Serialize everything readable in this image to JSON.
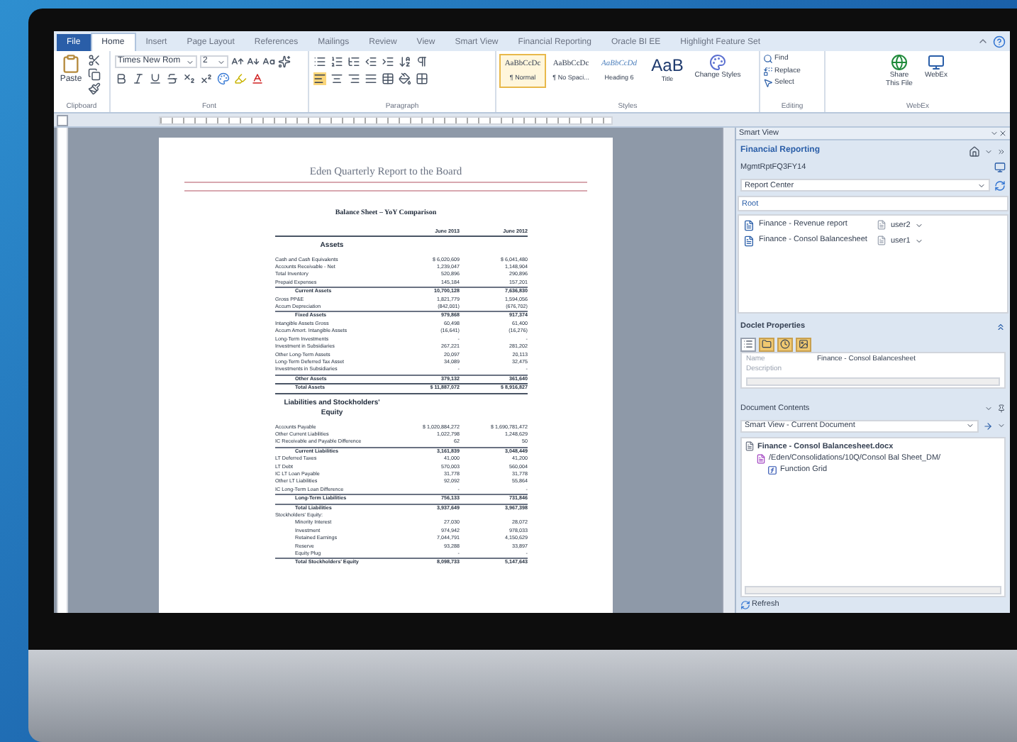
{
  "ribbon_tabs": [
    {
      "label": "File",
      "kind": "file",
      "selected": false
    },
    {
      "label": "Home",
      "kind": "tab",
      "selected": true
    },
    {
      "label": "Insert",
      "kind": "tab",
      "selected": false
    },
    {
      "label": "Page Layout",
      "kind": "tab",
      "selected": false
    },
    {
      "label": "References",
      "kind": "tab",
      "selected": false
    },
    {
      "label": "Mailings",
      "kind": "tab",
      "selected": false
    },
    {
      "label": "Review",
      "kind": "tab",
      "selected": false
    },
    {
      "label": "View",
      "kind": "tab",
      "selected": false
    },
    {
      "label": "Smart View",
      "kind": "tab",
      "selected": false
    },
    {
      "label": "Financial Reporting",
      "kind": "tab",
      "selected": false
    },
    {
      "label": "Oracle BI EE",
      "kind": "tab",
      "selected": false
    },
    {
      "label": "Highlight Feature Set",
      "kind": "tab",
      "selected": false
    }
  ],
  "ribbon": {
    "clipboard": {
      "paste": "Paste",
      "label": "Clipboard"
    },
    "font": {
      "family": "Times New Rom",
      "size": "2",
      "label": "Font"
    },
    "paragraph": {
      "label": "Paragraph"
    },
    "styles": {
      "label": "Styles",
      "change": "Change Styles",
      "items": [
        {
          "sample": "AaBbCcDc",
          "name": "¶ Normal",
          "kind": "normal",
          "selected": true
        },
        {
          "sample": "AaBbCcDc",
          "name": "¶ No Spaci...",
          "kind": "normal",
          "selected": false
        },
        {
          "sample": "AaBbCcDd",
          "name": "Heading 6",
          "kind": "heading",
          "selected": false
        },
        {
          "sample": "AaB",
          "name": "Title",
          "kind": "title",
          "selected": false
        }
      ]
    },
    "editing": {
      "label": "Editing",
      "find": "Find",
      "replace": "Replace",
      "select": "Select"
    },
    "webex": {
      "label": "WebEx",
      "share": "Share This File",
      "webex": "WebEx"
    }
  },
  "document": {
    "header": "Eden Quarterly Report to the Board",
    "title": "Balance Sheet – YoY Comparison",
    "columns": [
      "June 2013",
      "June 2012"
    ],
    "sections": [
      {
        "heading": "Assets",
        "rows": [
          {
            "label": "Cash and Cash Equivalents",
            "kind": "item",
            "values": [
              "$ 6,020,609",
              "$ 6,041,480"
            ]
          },
          {
            "label": "Accounts Receivable - Net",
            "kind": "item",
            "values": [
              "1,239,047",
              "1,148,904"
            ]
          },
          {
            "label": "Total Inventory",
            "kind": "item",
            "values": [
              "520,896",
              "290,896"
            ]
          },
          {
            "label": "Prepaid Expenses",
            "kind": "item",
            "values": [
              "145,184",
              "157,201"
            ]
          },
          {
            "label": "Current Assets",
            "kind": "total",
            "values": [
              "10,700,128",
              "7,636,830"
            ]
          },
          {
            "label": "Gross PP&E",
            "kind": "item",
            "values": [
              "1,821,779",
              "1,594,056"
            ]
          },
          {
            "label": "Accum Depreciation",
            "kind": "item",
            "values": [
              "(842,001)",
              "(676,702)"
            ]
          },
          {
            "label": "Fixed Assets",
            "kind": "total",
            "values": [
              "979,868",
              "917,374"
            ]
          },
          {
            "label": "Intangible Assets Gross",
            "kind": "item",
            "values": [
              "60,498",
              "61,400"
            ]
          },
          {
            "label": "Accum Amort. Intangible Assets",
            "kind": "item",
            "values": [
              "(16,641)",
              "(16,276)"
            ]
          },
          {
            "label": "Long-Term Investments",
            "kind": "item",
            "values": [
              "-",
              "-"
            ]
          },
          {
            "label": "Investment in Subsidiaries",
            "kind": "item",
            "values": [
              "267,221",
              "281,202"
            ]
          },
          {
            "label": "Other Long-Term Assets",
            "kind": "item",
            "values": [
              "20,097",
              "20,113"
            ]
          },
          {
            "label": "Long-Term Deferred Tax Asset",
            "kind": "item",
            "values": [
              "34,089",
              "32,475"
            ]
          },
          {
            "label": "Investments in Subsidiaries",
            "kind": "item",
            "values": [
              "-",
              "-"
            ]
          },
          {
            "label": "Other Assets",
            "kind": "total",
            "values": [
              "379,132",
              "361,640"
            ]
          },
          {
            "label": "Total Assets",
            "kind": "grand",
            "values": [
              "$ 11,887,072",
              "$ 8,916,827"
            ]
          }
        ]
      },
      {
        "heading": "Liabilities and Stockholders' Equity",
        "rows": [
          {
            "label": "Accounts Payable",
            "kind": "item",
            "values": [
              "$ 1,020,884,272",
              "$ 1,690,781,472"
            ]
          },
          {
            "label": "Other Current Liabilities",
            "kind": "item",
            "values": [
              "1,022,798",
              "1,248,629"
            ]
          },
          {
            "label": "IC Receivable and Payable Difference",
            "kind": "item",
            "values": [
              "62",
              "50"
            ]
          },
          {
            "label": "Current Liabilities",
            "kind": "total",
            "values": [
              "3,161,839",
              "3,048,449"
            ]
          },
          {
            "label": "LT Deferred Taxes",
            "kind": "item",
            "values": [
              "41,000",
              "41,200"
            ]
          },
          {
            "label": "LT Debt",
            "kind": "item",
            "values": [
              "570,003",
              "560,004"
            ]
          },
          {
            "label": "IC LT Loan Payable",
            "kind": "item",
            "values": [
              "31,778",
              "31,778"
            ]
          },
          {
            "label": "Other LT Liabilities",
            "kind": "item",
            "values": [
              "92,092",
              "55,864"
            ]
          },
          {
            "label": "IC Long-Term Loan Difference",
            "kind": "item",
            "values": [
              "-",
              "-"
            ]
          },
          {
            "label": "Long-Term Liabilities",
            "kind": "total",
            "values": [
              "756,133",
              "731,846"
            ]
          },
          {
            "label": "Total Liabilities",
            "kind": "total",
            "values": [
              "3,937,649",
              "3,967,398"
            ]
          },
          {
            "label": "Stockholders' Equity:",
            "kind": "label",
            "values": []
          },
          {
            "label": "Minority Interest",
            "kind": "sub",
            "values": [
              "27,030",
              "28,072"
            ]
          },
          {
            "label": "Investment",
            "kind": "sub",
            "values": [
              "974,942",
              "978,033"
            ]
          },
          {
            "label": "Retained Earnings",
            "kind": "sub",
            "values": [
              "7,044,791",
              "4,150,629"
            ]
          },
          {
            "label": "Reserve",
            "kind": "sub",
            "values": [
              "93,288",
              "33,897"
            ]
          },
          {
            "label": "Equity Plug",
            "kind": "sub",
            "values": [
              "-",
              "-"
            ]
          },
          {
            "label": "Total Stockholders' Equity",
            "kind": "total",
            "values": [
              "8,098,733",
              "5,147,643"
            ]
          }
        ]
      }
    ]
  },
  "smart_view": {
    "title": "Smart View",
    "provider": "Financial Reporting",
    "connection": "MgmtRptFQ3FY14",
    "repository": "Report Center",
    "path": "Root",
    "reports": [
      {
        "name": "Finance - Revenue report",
        "owner": "user2"
      },
      {
        "name": "Finance - Consol Balancesheet",
        "owner": "user1"
      }
    ],
    "doclet_properties": {
      "title": "Doclet Properties",
      "tabs": [
        {
          "kind": "list",
          "selected": true
        },
        {
          "kind": "folder",
          "selected": false
        },
        {
          "kind": "clock",
          "selected": false
        },
        {
          "kind": "image",
          "selected": false
        }
      ],
      "rows": [
        {
          "name": "Name",
          "value": "Finance - Consol Balancesheet"
        },
        {
          "name": "Description"
        }
      ]
    },
    "document_contents": {
      "title": "Document Contents",
      "view": "Smart View - Current Document",
      "tree": [
        {
          "label": "Finance - Consol Balancesheet.docx",
          "kind": "document",
          "children": [
            {
              "label": "/Eden/Consolidations/10Q/Consol Bal Sheet_DM/",
              "kind": "report",
              "children": [
                {
                  "label": "Function Grid",
                  "kind": "function"
                }
              ]
            }
          ]
        }
      ]
    },
    "refresh": "Refresh"
  }
}
